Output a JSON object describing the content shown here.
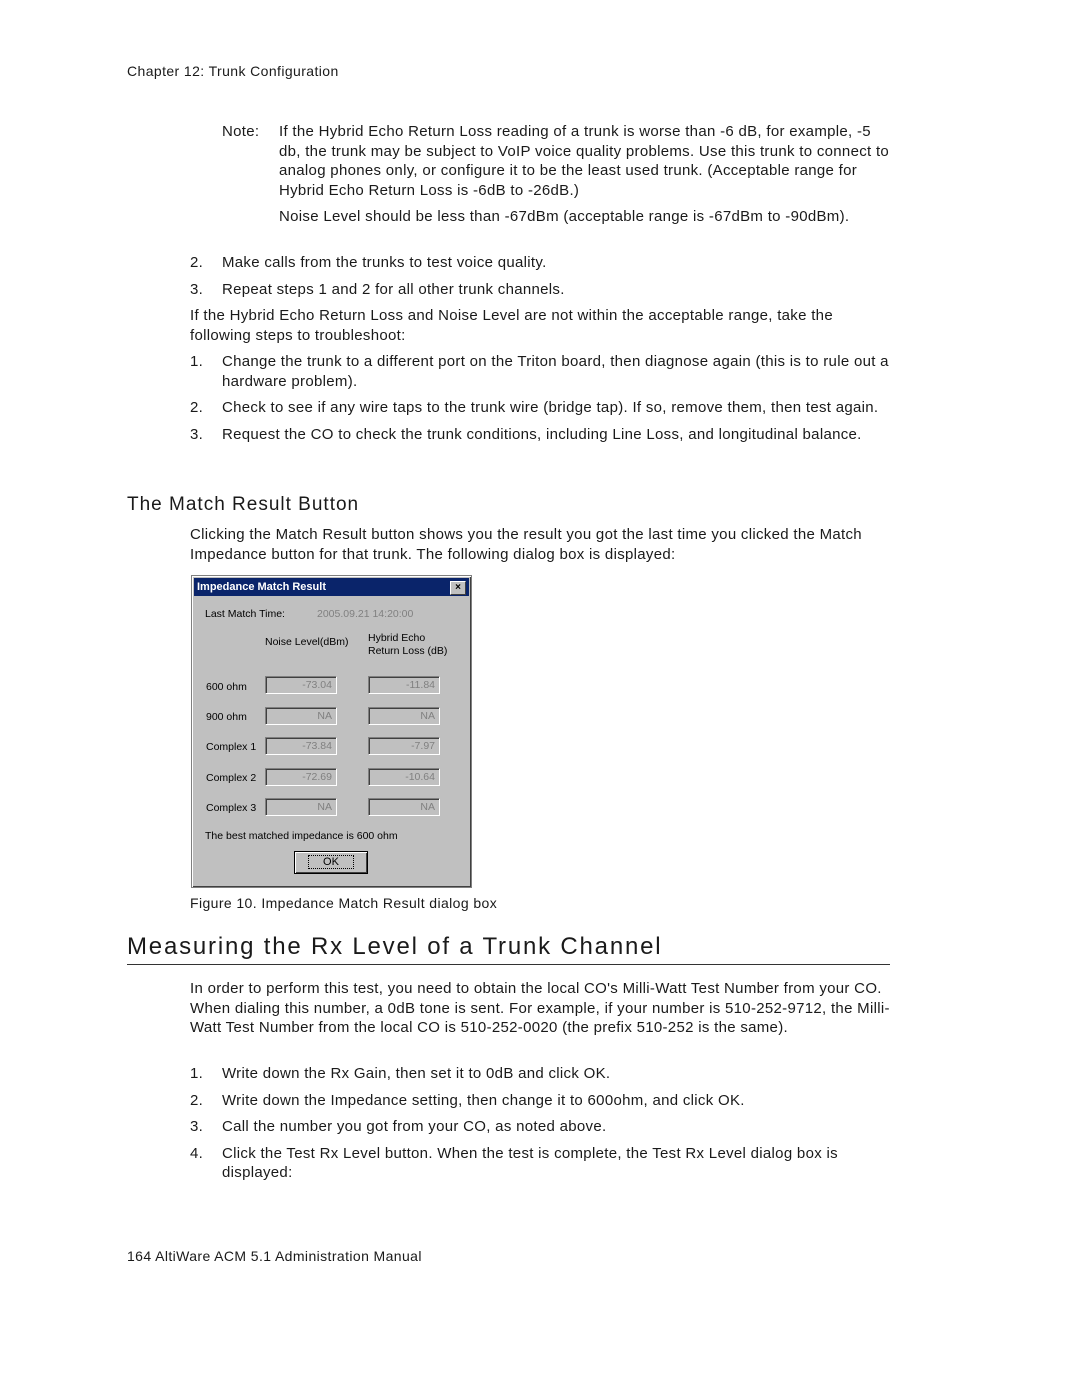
{
  "running_head": "Chapter 12:  Trunk Configuration",
  "note": {
    "label": "Note:",
    "paragraphs": [
      "If the Hybrid Echo Return Loss reading of a trunk is worse than -6 dB, for example, -5 db, the trunk may be subject to VoIP voice quality problems. Use this trunk to connect to analog phones only, or configure it to be the least used trunk. (Acceptable range for Hybrid Echo Return Loss is -6dB to -26dB.)",
      "Noise Level should be less than -67dBm (acceptable range is -67dBm to -90dBm)."
    ]
  },
  "steps_a": [
    {
      "num": "2.",
      "text": "Make calls from the trunks to test voice quality."
    },
    {
      "num": "3.",
      "text": "Repeat steps 1 and 2 for all other trunk channels."
    }
  ],
  "troubleshoot_intro": "If the Hybrid Echo Return Loss and Noise Level are not within the acceptable range, take the following steps to troubleshoot:",
  "steps_b": [
    {
      "num": "1.",
      "text": "Change the trunk to a different port on the Triton board, then diagnose again (this is to rule out a hardware problem)."
    },
    {
      "num": "2.",
      "text": "Check to see if any wire taps to the trunk wire (bridge tap). If so, remove them, then test again."
    },
    {
      "num": "3.",
      "text": "Request the CO to check the trunk conditions, including Line Loss, and longitudinal balance."
    }
  ],
  "section_match": {
    "heading": "The Match Result Button",
    "body": "Clicking the Match Result button shows you the result you got the last time you clicked the Match Impedance button for that trunk. The following dialog box is displayed:"
  },
  "dialog": {
    "title": "Impedance Match Result",
    "close_label": "×",
    "last_match_label": "Last Match Time:",
    "last_match_value": "2005.09.21 14:20:00",
    "col_noise": "Noise Level(dBm)",
    "col_echo_1": "Hybrid Echo",
    "col_echo_2": "Return Loss (dB)",
    "rows": [
      {
        "label": "600 ohm",
        "noise": "-73.04",
        "echo": "-11.84"
      },
      {
        "label": "900 ohm",
        "noise": "NA",
        "echo": "NA"
      },
      {
        "label": "Complex 1",
        "noise": "-73.84",
        "echo": "-7.97"
      },
      {
        "label": "Complex 2",
        "noise": "-72.69",
        "echo": "-10.64"
      },
      {
        "label": "Complex 3",
        "noise": "NA",
        "echo": "NA"
      }
    ],
    "best_match": "The best matched impedance is 600 ohm",
    "ok_label": "OK"
  },
  "figure_caption": "Figure 10.   Impedance Match Result dialog box",
  "section_rx": {
    "heading": "Measuring the Rx Level of a Trunk Channel",
    "body": "In order to perform this test, you need to obtain the local CO's Milli-Watt Test Number from your CO. When dialing this number, a 0dB tone is sent. For example, if your number is 510-252-9712, the Milli-Watt Test Number from the local CO is 510-252-0020 (the prefix 510-252 is the same).",
    "steps": [
      {
        "num": "1.",
        "text": "Write down the Rx Gain, then set it to 0dB and click OK."
      },
      {
        "num": "2.",
        "text": "Write down the Impedance setting, then change it to 600ohm, and click OK."
      },
      {
        "num": "3.",
        "text": "Call the number you got from your CO, as noted above."
      },
      {
        "num": "4.",
        "text": "Click the Test Rx Level button. When the test is complete, the Test Rx Level dialog box is displayed:"
      }
    ]
  },
  "footer": "164   AltiWare ACM 5.1 Administration Manual"
}
